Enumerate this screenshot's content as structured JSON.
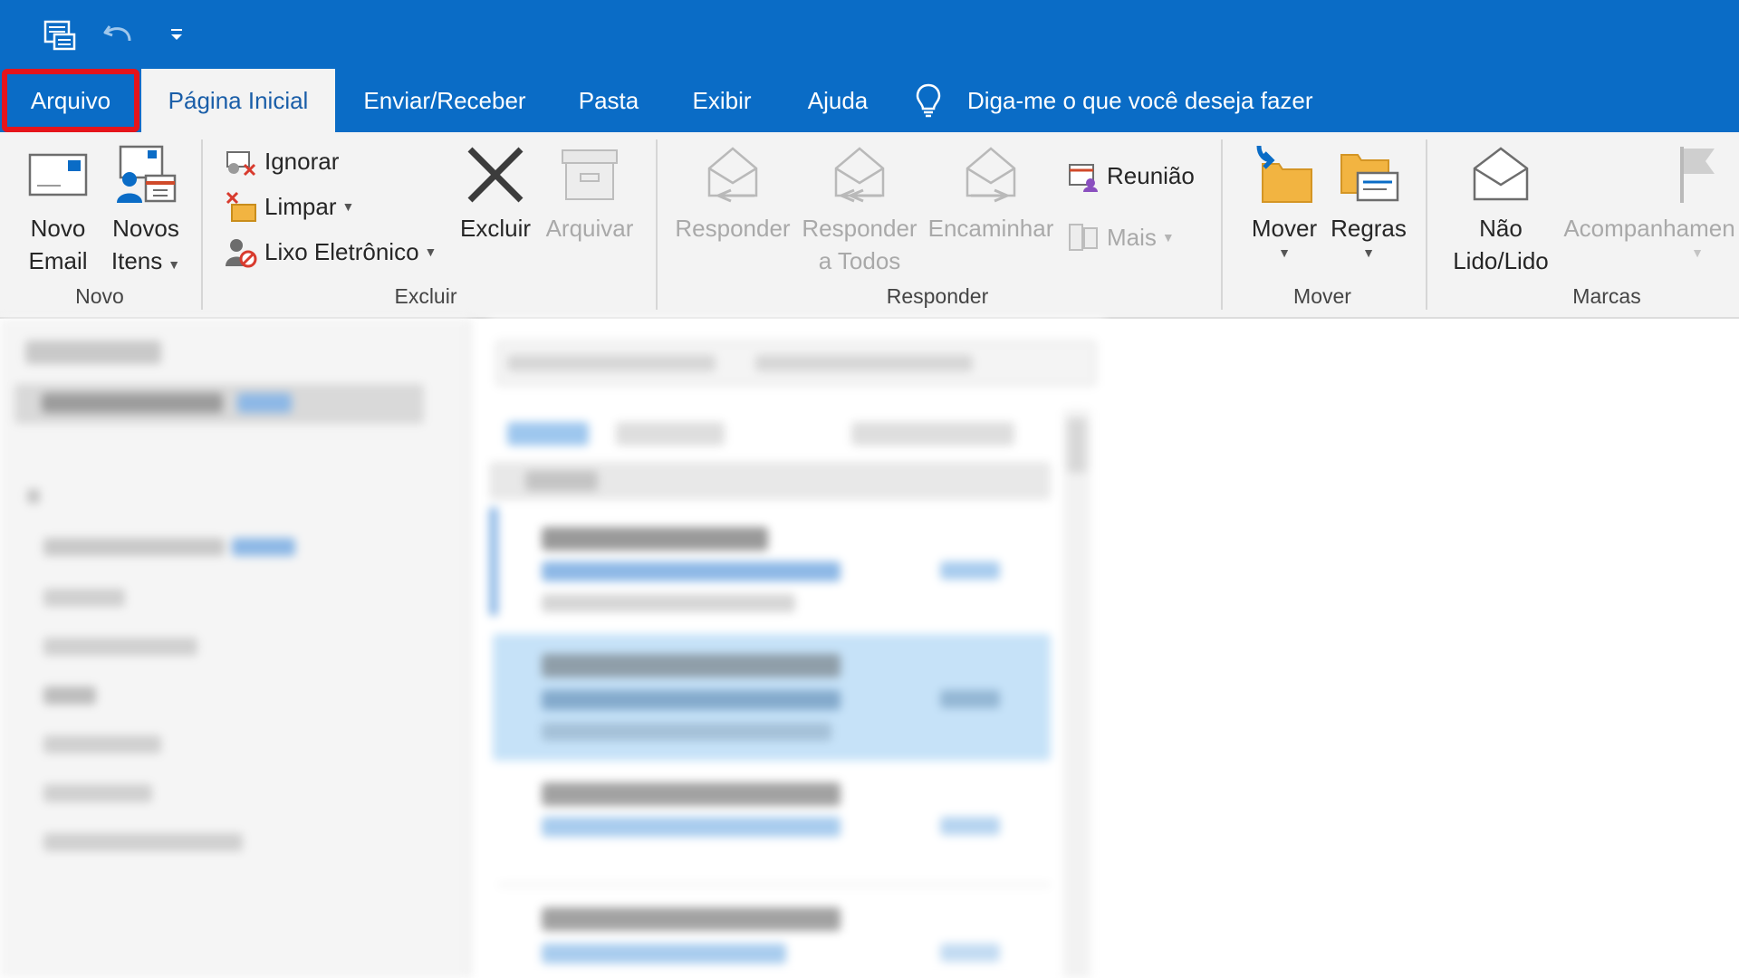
{
  "quick_access": {
    "icons": [
      "send-receive-icon",
      "undo-icon",
      "customize-qat-icon"
    ]
  },
  "tabs": [
    {
      "label": "Arquivo"
    },
    {
      "label": "Página Inicial"
    },
    {
      "label": "Enviar/Receber"
    },
    {
      "label": "Pasta"
    },
    {
      "label": "Exibir"
    },
    {
      "label": "Ajuda"
    }
  ],
  "tell_me": "Diga-me o que você deseja fazer",
  "ribbon": {
    "groups": {
      "novo": "Novo",
      "excluir": "Excluir",
      "responder": "Responder",
      "mover": "Mover",
      "marcas": "Marcas"
    },
    "novo_email": [
      "Novo",
      "Email"
    ],
    "novos_itens": [
      "Novos",
      "Itens"
    ],
    "ignorar": "Ignorar",
    "limpar": "Limpar",
    "lixo": "Lixo Eletrônico",
    "excluir": "Excluir",
    "arquivar": "Arquivar",
    "responder": "Responder",
    "responder_todos": [
      "Responder",
      "a Todos"
    ],
    "encaminhar": "Encaminhar",
    "reuniao": "Reunião",
    "mais": "Mais",
    "mover": "Mover",
    "regras": "Regras",
    "nao_lido": [
      "Não",
      "Lido/Lido"
    ],
    "acompanhamento": "Acompanhamen"
  },
  "colors": {
    "accent": "#0a6cc6",
    "highlight": "#e5141b",
    "ribbon_bg": "#f3f3f3"
  }
}
